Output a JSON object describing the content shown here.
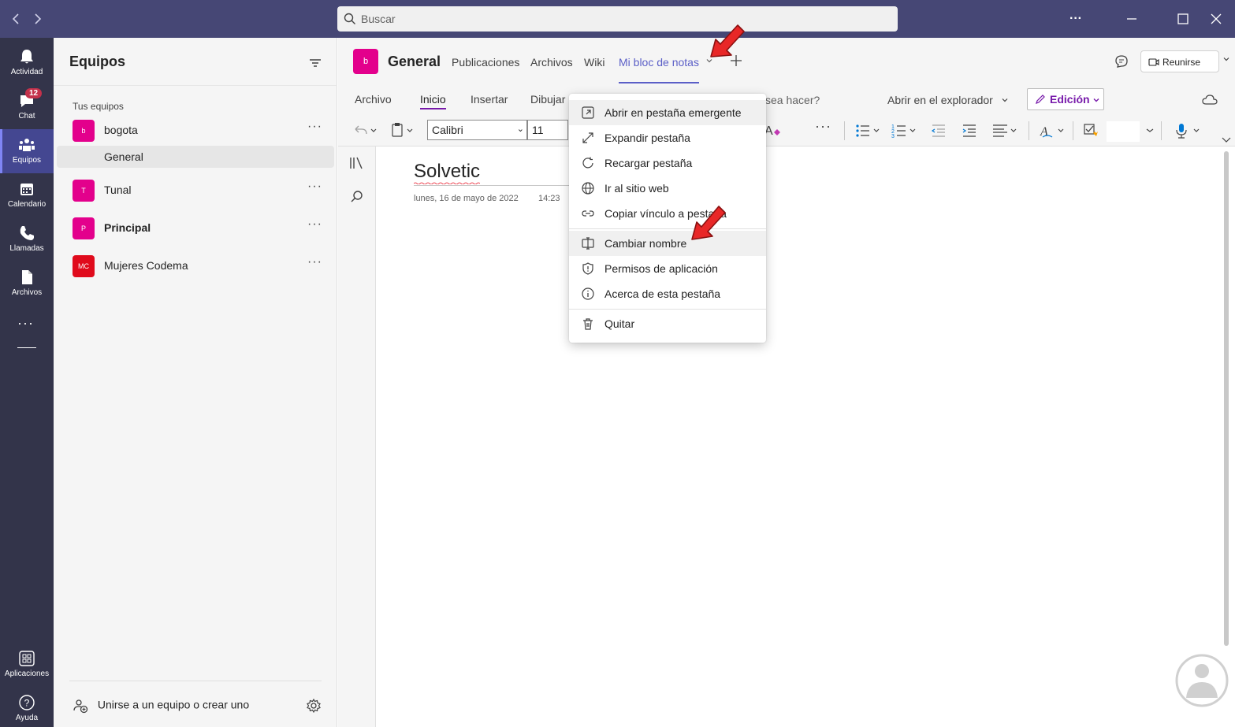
{
  "titlebar": {
    "search_placeholder": "Buscar",
    "more": "···"
  },
  "rail": {
    "items": [
      {
        "label": "Actividad"
      },
      {
        "label": "Chat",
        "badge": "12"
      },
      {
        "label": "Equipos"
      },
      {
        "label": "Calendario"
      },
      {
        "label": "Llamadas"
      },
      {
        "label": "Archivos"
      }
    ],
    "more": "···",
    "bottom": [
      {
        "label": "Aplicaciones"
      },
      {
        "label": "Ayuda"
      }
    ]
  },
  "teams_panel": {
    "title": "Equipos",
    "section_label": "Tus equipos",
    "teams": [
      {
        "initials": "b",
        "name": "bogota",
        "color": "#e3008c"
      },
      {
        "initials": "T",
        "name": "Tunal",
        "color": "#e3008c"
      },
      {
        "initials": "P",
        "name": "Principal",
        "color": "#e3008c"
      },
      {
        "initials": "MC",
        "name": "Mujeres Codema",
        "color": "#e00b1c"
      }
    ],
    "selected_channel": "General",
    "team_more": "···",
    "join_label": "Unirse a un equipo o crear uno"
  },
  "channel_header": {
    "avatar": "b",
    "title": "General",
    "tabs": [
      "Publicaciones",
      "Archivos",
      "Wiki",
      "Mi bloc de notas"
    ],
    "active_tab": "Mi bloc de notas",
    "meet_label": "Reunirse"
  },
  "ribbon": {
    "tabs": [
      "Archivo",
      "Inicio",
      "Insertar",
      "Dibujar"
    ],
    "tell_me": "sea hacer?",
    "open_browser": "Abrir en el explorador",
    "edit_label": "Edición",
    "font": "Calibri",
    "size": "11"
  },
  "page": {
    "title": "Solvetic",
    "date": "lunes, 16 de mayo de 2022",
    "time": "14:23"
  },
  "menu": {
    "items": [
      "Abrir en pestaña emergente",
      "Expandir pestaña",
      "Recargar pestaña",
      "Ir al sitio web",
      "Copiar vínculo a pestaña",
      "Cambiar nombre",
      "Permisos de aplicación",
      "Acerca de esta pestaña",
      "Quitar"
    ]
  },
  "colors": {
    "rail": "#33344a",
    "titlebar": "#464775",
    "accent": "#5b5fc7",
    "onenote": "#7719aa",
    "team_avatar": "#e3008c"
  }
}
